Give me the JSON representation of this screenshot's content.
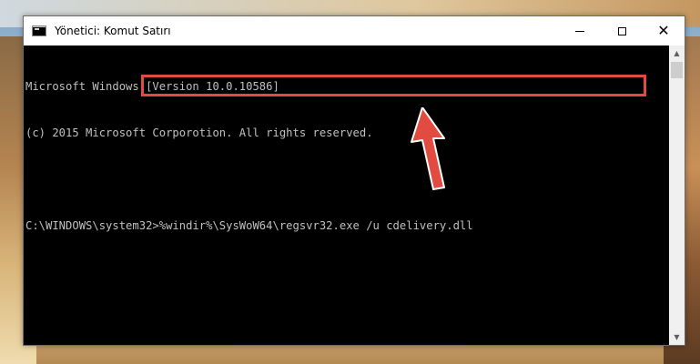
{
  "window": {
    "title": "Yönetici: Komut Satırı",
    "icon": "cmd-icon"
  },
  "caption": {
    "minimize_icon": "minimize-icon",
    "maximize_icon": "maximize-icon",
    "close_icon": "close-icon",
    "close_glyph": "✕"
  },
  "console": {
    "lines": [
      "Microsoft Windows [Version 10.0.10586]",
      "(c) 2015 Microsoft Corporotion. All rights reserved.",
      "",
      "C:\\WINDOWS\\system32>%windir%\\SysWoW64\\regsvr32.exe /u cdelivery.dll"
    ]
  },
  "scrollbar": {
    "up_glyph": "▲",
    "down_glyph": "▼"
  },
  "colors": {
    "highlight": "#e24b3f",
    "arrow": "#e24b3f",
    "console_bg": "#000000",
    "console_text": "#c0c0c0"
  }
}
